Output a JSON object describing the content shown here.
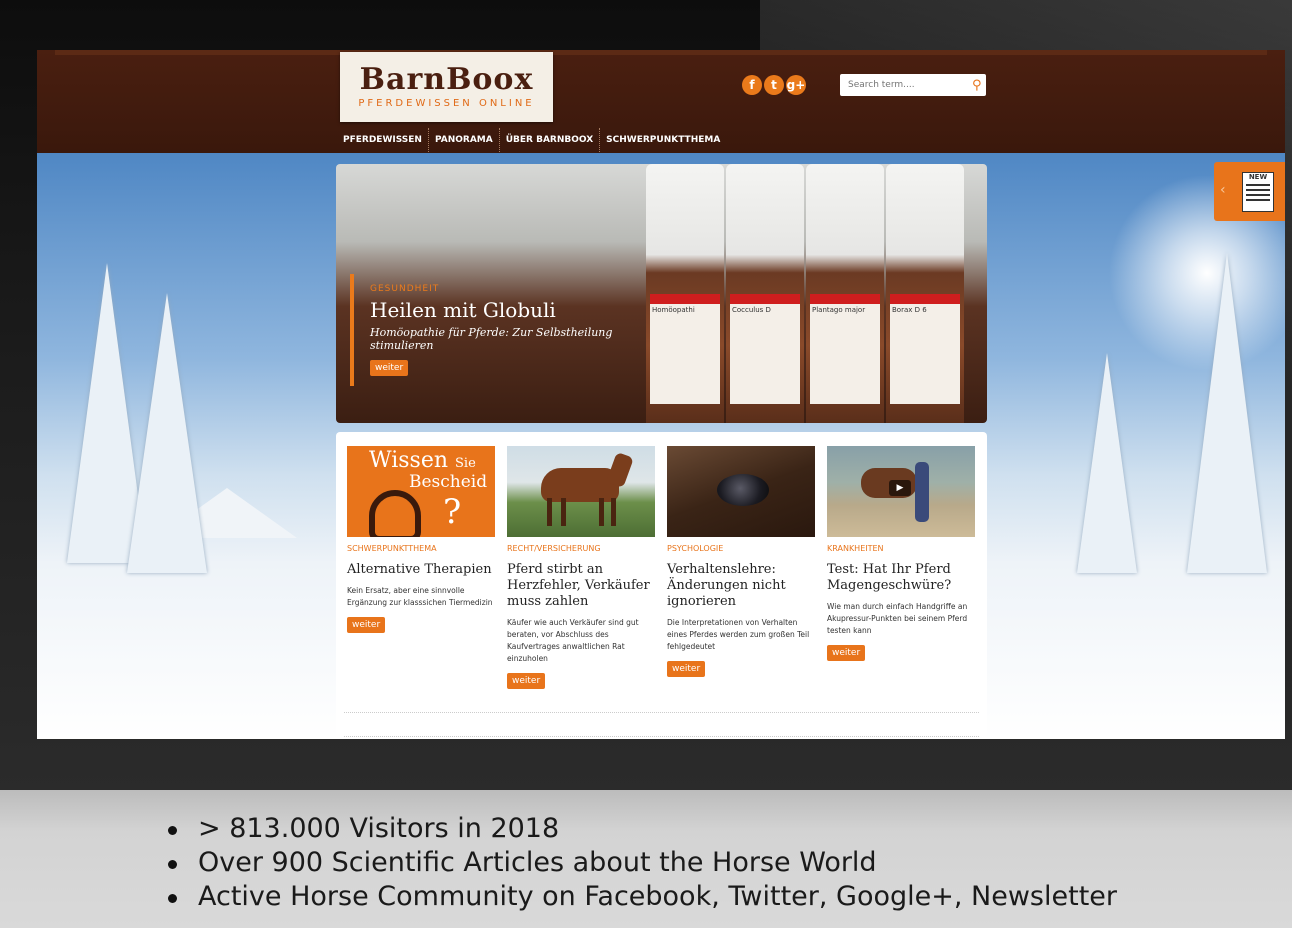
{
  "header": {
    "logo_main": "BarnBoox",
    "logo_sub": "PFERDEWISSEN ONLINE",
    "social": [
      "f",
      "t",
      "g+"
    ],
    "search_placeholder": "Search term....",
    "nav": [
      "PFERDEWISSEN",
      "PANORAMA",
      "ÜBER BARNBOOX",
      "SCHWERPUNKTTHEMA"
    ]
  },
  "hero": {
    "category": "GESUNDHEIT",
    "title": "Heilen mit Globuli",
    "subtitle": "Homöopathie für Pferde: Zur Selbstheilung stimulieren",
    "button": "weiter",
    "labels": [
      "Homöopathi",
      "Cocculus D",
      "Plantago major",
      "Borax D 6"
    ]
  },
  "articles": [
    {
      "thumb_text_1": "Wissen",
      "thumb_text_2": "Sie",
      "thumb_text_3": "Bescheid",
      "thumb_text_4": "?",
      "category": "SCHWERPUNKTTHEMA",
      "title": "Alternative Therapien",
      "text": "Kein Ersatz, aber eine sinnvolle Ergänzung zur klasssichen Tiermedizin",
      "button": "weiter"
    },
    {
      "category": "RECHT/VERSICHERUNG",
      "title": "Pferd stirbt an Herzfehler, Verkäufer muss zahlen",
      "text": "Käufer wie auch Verkäufer sind gut beraten, vor Abschluss des Kaufvertrages anwaltlichen Rat einzuholen",
      "button": "weiter"
    },
    {
      "category": "PSYCHOLOGIE",
      "title": "Verhaltenslehre: Änderungen nicht ignorieren",
      "text": "Die Interpretationen von Verhalten eines Pferdes werden zum großen Teil fehlgedeutet",
      "button": "weiter"
    },
    {
      "category": "KRANKHEITEN",
      "title": "Test: Hat Ihr Pferd Magengeschwüre?",
      "text": "Wie man durch einfach Handgriffe an Akupressur-Punkten bei seinem Pferd testen kann",
      "button": "weiter"
    }
  ],
  "new_tab": {
    "label": "NEW"
  },
  "bullets": [
    "> 813.000 Visitors in 2018",
    "Over 900 Scientific Articles about the Horse World",
    "Active Horse Community on Facebook, Twitter, Google+, Newsletter"
  ],
  "colors": {
    "accent": "#e8741b",
    "header": "#3f1a0d"
  }
}
